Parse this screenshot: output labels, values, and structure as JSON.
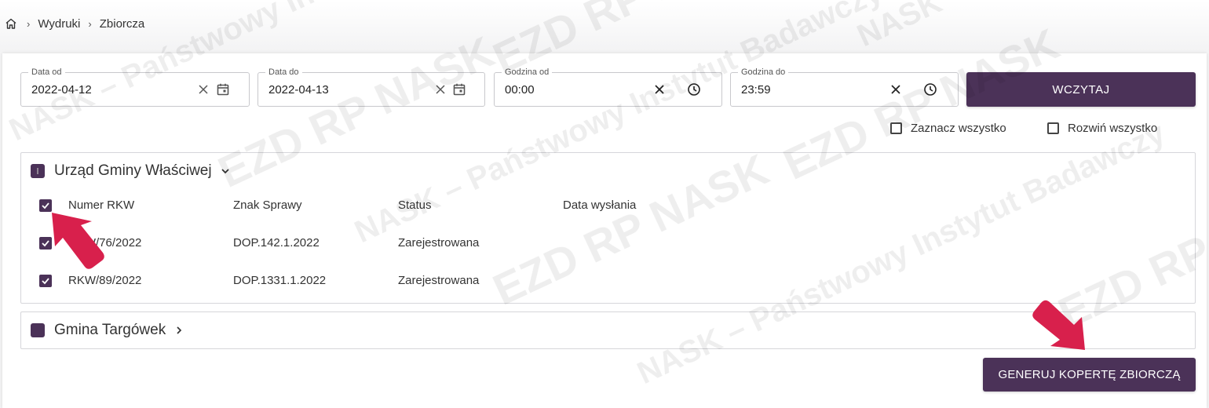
{
  "breadcrumb": {
    "items": [
      "Wydruki",
      "Zbiorcza"
    ]
  },
  "filters": {
    "date_from": {
      "label": "Data od",
      "value": "2022-04-12"
    },
    "date_to": {
      "label": "Data do",
      "value": "2022-04-13"
    },
    "time_from": {
      "label": "Godzina od",
      "value": "00:00"
    },
    "time_to": {
      "label": "Godzina do",
      "value": "23:59"
    },
    "load_button": "WCZYTAJ"
  },
  "options": {
    "select_all": "Zaznacz wszystko",
    "expand_all": "Rozwiń wszystko"
  },
  "groups": [
    {
      "title": "Urząd Gminy Właściwej",
      "expanded": true,
      "columns": [
        "Numer RKW",
        "Znak Sprawy",
        "Status",
        "Data wysłania"
      ],
      "rows": [
        {
          "numer": "RKW/76/2022",
          "znak": "DOP.142.1.2022",
          "status": "Zarejestrowana",
          "data": ""
        },
        {
          "numer": "RKW/89/2022",
          "znak": "DOP.1331.1.2022",
          "status": "Zarejestrowana",
          "data": ""
        }
      ]
    },
    {
      "title": "Gmina Targówek",
      "expanded": false
    }
  ],
  "generate_button": "GENERUJ KOPERTĘ ZBIORCZĄ",
  "watermark": {
    "text": "NASK – Państwowy Instytut Badawczy",
    "logo": "EZD",
    "logo_sup": "RP",
    "logo_sub": "NASK"
  },
  "colors": {
    "primary": "#4b3258",
    "annotation_arrow": "#d8204c"
  },
  "icons": [
    "home-icon",
    "chevron-right-icon",
    "close-icon",
    "calendar-icon",
    "clock-icon",
    "chevron-down-icon"
  ]
}
